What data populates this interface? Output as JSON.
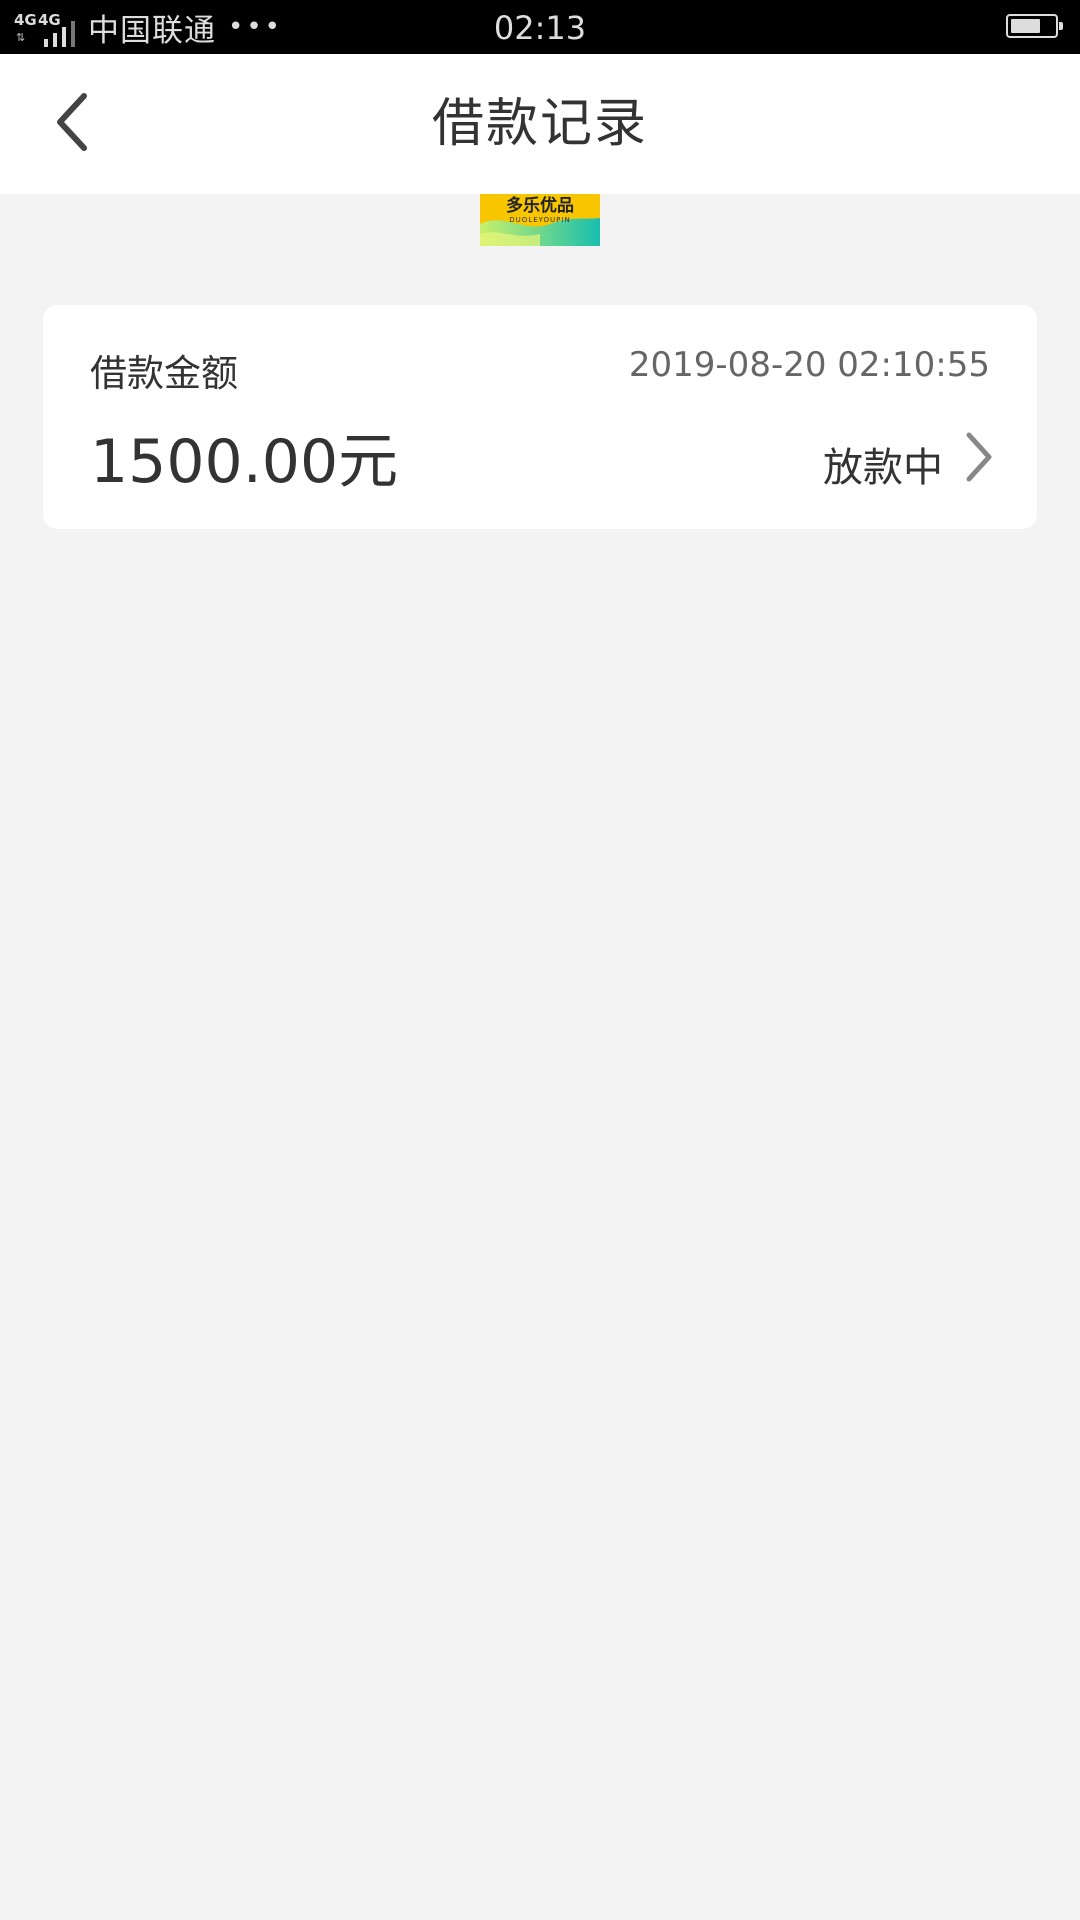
{
  "status_bar": {
    "network_1": "4G",
    "network_2": "4G",
    "carrier": "中国联通",
    "dots": "•••",
    "time": "02:13",
    "battery_level": 0.68
  },
  "nav": {
    "title": "借款记录",
    "back_icon": "chevron-left-icon"
  },
  "banner": {
    "logo_text": "多乐优品",
    "logo_sub": "DUOLEYOUPIN"
  },
  "records": [
    {
      "label": "借款金额",
      "datetime": "2019-08-20 02:10:55",
      "amount": "1500.00元",
      "status": "放款中",
      "chevron_icon": "chevron-right-icon"
    }
  ],
  "colors": {
    "background": "#f3f3f3",
    "card": "#ffffff",
    "text_primary": "#333333",
    "text_secondary": "#666666",
    "banner_yellow": "#f7c600",
    "banner_green": "#27c3a6"
  }
}
